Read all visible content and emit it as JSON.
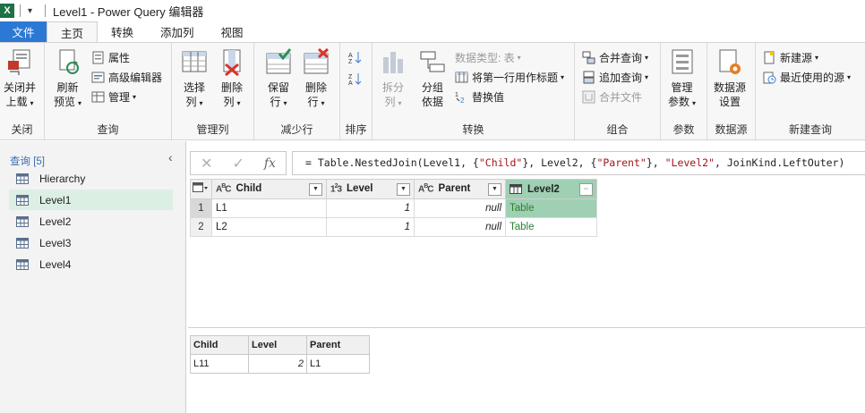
{
  "window": {
    "title": "Level1 - Power Query 编辑器",
    "app_logo": "X"
  },
  "tabs": [
    "文件",
    "主页",
    "转换",
    "添加列",
    "视图"
  ],
  "ribbon": {
    "close_load": [
      "关闭并",
      "上载"
    ],
    "refresh": [
      "刷新",
      "预览"
    ],
    "properties": "属性",
    "advanced_editor": "高级编辑器",
    "manage": "管理",
    "choose_cols": [
      "选择",
      "列"
    ],
    "remove_cols": [
      "删除",
      "列"
    ],
    "keep_rows": [
      "保留",
      "行"
    ],
    "remove_rows": [
      "删除",
      "行"
    ],
    "split_col": [
      "拆分",
      "列"
    ],
    "group_by": [
      "分组",
      "依据"
    ],
    "data_type": "数据类型: 表",
    "first_row_header": "将第一行用作标题",
    "replace_values": "替换值",
    "merge_queries": "合并查询",
    "append_queries": "追加查询",
    "combine_files": "合并文件",
    "manage_params": [
      "管理",
      "参数"
    ],
    "data_source_settings": [
      "数据源",
      "设置"
    ],
    "new_source": "新建源",
    "recent_sources": "最近使用的源",
    "group_labels": {
      "close": "关闭",
      "query": "查询",
      "manage_cols": "管理列",
      "reduce_rows": "减少行",
      "sort": "排序",
      "transform": "转换",
      "combine": "组合",
      "params": "参数",
      "data_source": "数据源",
      "new_query": "新建查询"
    }
  },
  "queries": {
    "header": "查询 [5]",
    "items": [
      "Hierarchy",
      "Level1",
      "Level2",
      "Level3",
      "Level4"
    ],
    "selected": "Level1"
  },
  "formula": {
    "prefix": "= Table.NestedJoin(Level1, {",
    "s1": "\"Child\"",
    "p2": "}, Level2, {",
    "s2": "\"Parent\"",
    "p3": "}, ",
    "s3": "\"Level2\"",
    "p4": ", JoinKind.LeftOuter)"
  },
  "grid": {
    "columns": [
      {
        "type": "ABC",
        "name": "Child"
      },
      {
        "type": "123",
        "name": "Level"
      },
      {
        "type": "ABC",
        "name": "Parent"
      },
      {
        "type": "table",
        "name": "Level2"
      }
    ],
    "rows": [
      {
        "num": "1",
        "child": "L1",
        "level": "1",
        "parent": "null",
        "level2": "Table"
      },
      {
        "num": "2",
        "child": "L2",
        "level": "1",
        "parent": "null",
        "level2": "Table"
      }
    ]
  },
  "preview": {
    "headers": [
      "Child",
      "Level",
      "Parent"
    ],
    "row": [
      "L11",
      "2",
      "L1"
    ]
  },
  "colors": {
    "file_tab": "#2b79d4",
    "selected_col": "#9fd0b4",
    "selected_query": "#dcefe3",
    "string_literal": "#a31515"
  }
}
